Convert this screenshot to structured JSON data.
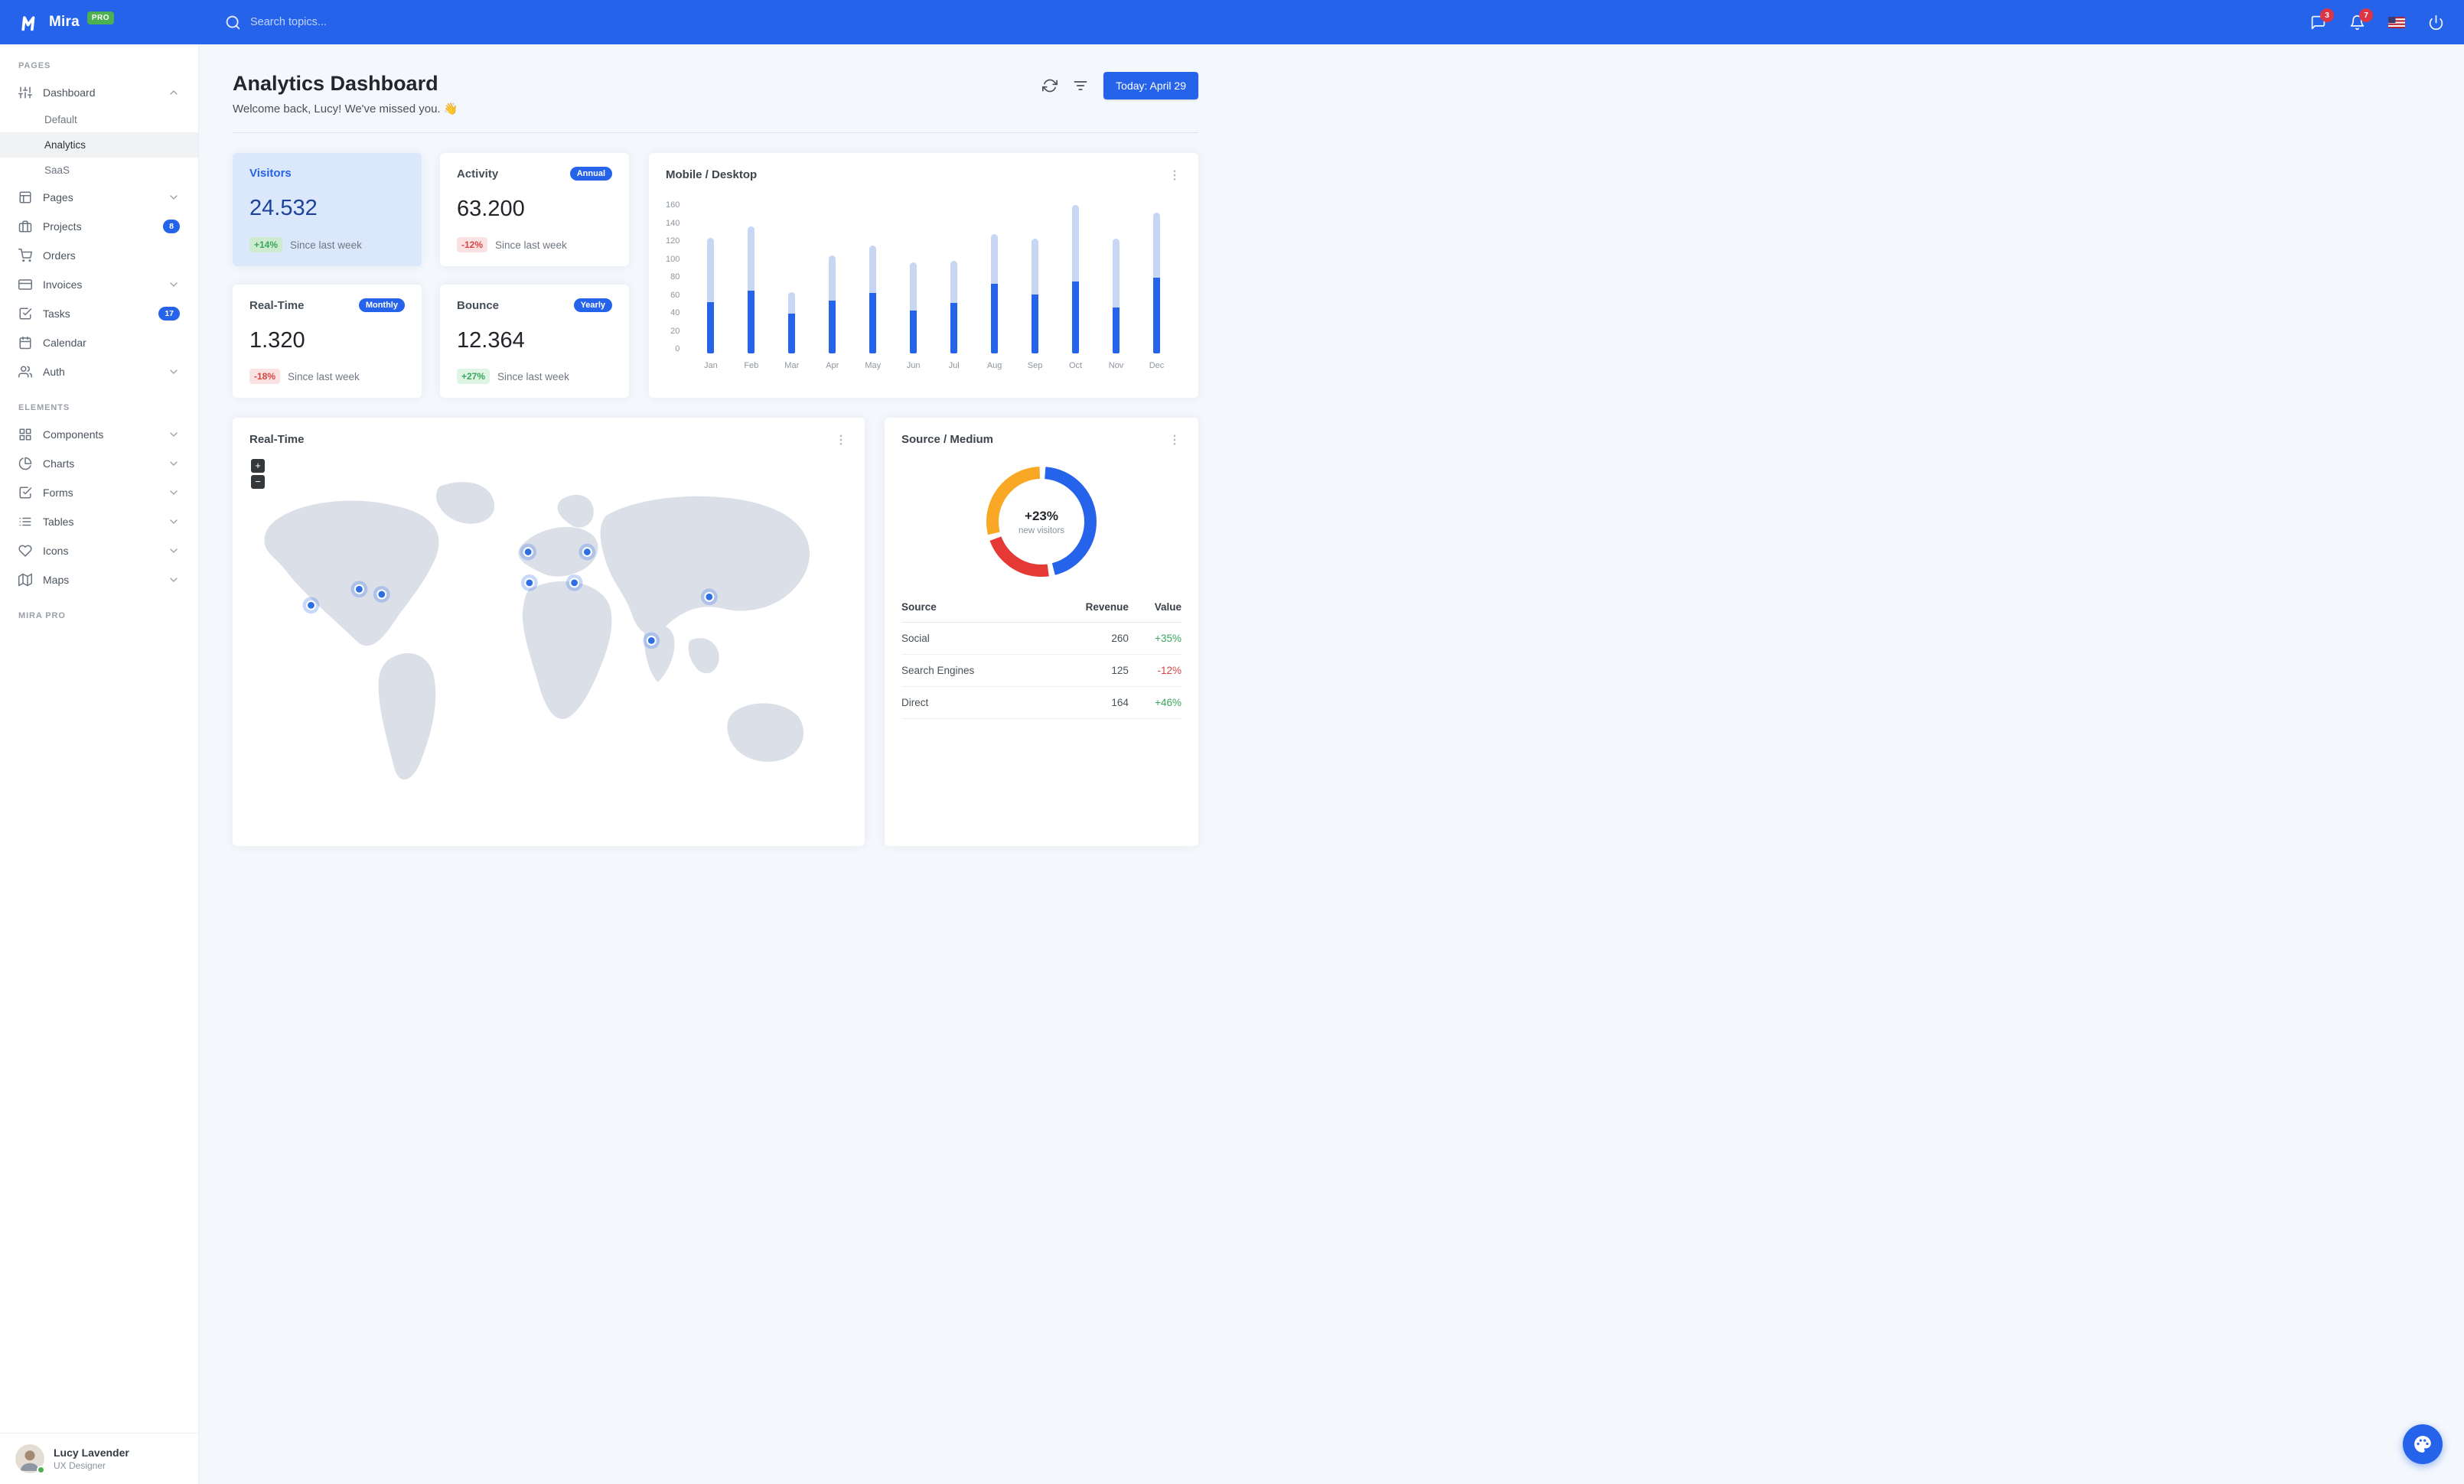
{
  "theme": {
    "primary": "#2563eb",
    "navbar_bg": "#2563eb",
    "badge_red": "#dc3545",
    "success_green": "#3aa65b",
    "danger_red": "#d64545",
    "pro_badge_green": "#4caf50",
    "highlight_card_bg": "#dbe7fa",
    "body_bg": "#f4f7fc"
  },
  "navbar": {
    "brand": "Mira",
    "brand_badge": "PRO",
    "search_placeholder": "Search topics...",
    "messages_badge": "3",
    "alerts_badge": "7"
  },
  "sidebar": {
    "sections": [
      {
        "label": "Pages",
        "items": [
          {
            "label": "Dashboard",
            "icon": "sliders",
            "state": "expanded",
            "children": [
              {
                "label": "Default"
              },
              {
                "label": "Analytics",
                "active": true
              },
              {
                "label": "SaaS"
              }
            ]
          },
          {
            "label": "Pages",
            "icon": "layout",
            "chevron": "down"
          },
          {
            "label": "Projects",
            "icon": "briefcase",
            "badge": "8"
          },
          {
            "label": "Orders",
            "icon": "shopping-cart"
          },
          {
            "label": "Invoices",
            "icon": "credit-card",
            "chevron": "down"
          },
          {
            "label": "Tasks",
            "icon": "check-square",
            "badge": "17"
          },
          {
            "label": "Calendar",
            "icon": "calendar"
          },
          {
            "label": "Auth",
            "icon": "users",
            "chevron": "down"
          }
        ]
      },
      {
        "label": "Elements",
        "items": [
          {
            "label": "Components",
            "icon": "grid",
            "chevron": "down"
          },
          {
            "label": "Charts",
            "icon": "pie-chart",
            "chevron": "down"
          },
          {
            "label": "Forms",
            "icon": "check-square",
            "chevron": "down"
          },
          {
            "label": "Tables",
            "icon": "list",
            "chevron": "down"
          },
          {
            "label": "Icons",
            "icon": "heart",
            "chevron": "down"
          },
          {
            "label": "Maps",
            "icon": "map",
            "chevron": "down"
          }
        ]
      },
      {
        "label": "Mira Pro",
        "items": []
      }
    ],
    "user": {
      "name": "Lucy Lavender",
      "role": "UX Designer",
      "status": "online"
    }
  },
  "header": {
    "title": "Analytics Dashboard",
    "subtitle": "Welcome back, Lucy! We've missed you. 👋",
    "today_button": "Today: April 29"
  },
  "stats": [
    {
      "title": "Visitors",
      "badge": null,
      "value": "24.532",
      "delta": "+14%",
      "delta_type": "positive",
      "caption": "Since last week",
      "highlight": true
    },
    {
      "title": "Activity",
      "badge": "Annual",
      "value": "63.200",
      "delta": "-12%",
      "delta_type": "negative",
      "caption": "Since last week",
      "highlight": false
    },
    {
      "title": "Real-Time",
      "badge": "Monthly",
      "value": "1.320",
      "delta": "-18%",
      "delta_type": "negative",
      "caption": "Since last week",
      "highlight": false
    },
    {
      "title": "Bounce",
      "badge": "Yearly",
      "value": "12.364",
      "delta": "+27%",
      "delta_type": "positive",
      "caption": "Since last week",
      "highlight": false
    }
  ],
  "chart_data": [
    {
      "type": "bar",
      "title": "Mobile / Desktop",
      "stacked": true,
      "categories": [
        "Jan",
        "Feb",
        "Mar",
        "Apr",
        "May",
        "Jun",
        "Jul",
        "Aug",
        "Sep",
        "Oct",
        "Nov",
        "Dec"
      ],
      "series": [
        {
          "name": "Mobile",
          "color": "#2563eb",
          "values": [
            54,
            66,
            42,
            55,
            63,
            45,
            53,
            73,
            62,
            75,
            48,
            79
          ]
        },
        {
          "name": "Desktop",
          "color": "#c7d6f3",
          "values": [
            67,
            67,
            22,
            47,
            50,
            50,
            44,
            52,
            58,
            80,
            72,
            68
          ]
        }
      ],
      "ylim": [
        0,
        160
      ],
      "yticks": [
        0,
        20,
        40,
        60,
        80,
        100,
        120,
        140,
        160
      ],
      "grid": false,
      "legend": "none"
    },
    {
      "type": "pie",
      "title": "Source / Medium",
      "center_value": "+23%",
      "center_label": "new visitors",
      "slices": [
        {
          "name": "Social",
          "value": 260,
          "color": "#2563eb"
        },
        {
          "name": "Search Engines",
          "value": 125,
          "color": "#e53935"
        },
        {
          "name": "Direct",
          "value": 164,
          "color": "#f9a825"
        }
      ],
      "legend": "none"
    }
  ],
  "realtime": {
    "title": "Real-Time",
    "zoom_in": "+",
    "zoom_out": "−",
    "markers": [
      {
        "x": 130,
        "y": 235
      },
      {
        "x": 205,
        "y": 210
      },
      {
        "x": 240,
        "y": 218
      },
      {
        "x": 468,
        "y": 152
      },
      {
        "x": 470,
        "y": 200
      },
      {
        "x": 540,
        "y": 200
      },
      {
        "x": 560,
        "y": 152
      },
      {
        "x": 660,
        "y": 290
      },
      {
        "x": 750,
        "y": 222
      }
    ]
  },
  "source_medium": {
    "table": {
      "headers": [
        "Source",
        "Revenue",
        "Value"
      ],
      "rows": [
        [
          "Social",
          "260",
          "+35%"
        ],
        [
          "Search Engines",
          "125",
          "-12%"
        ],
        [
          "Direct",
          "164",
          "+46%"
        ]
      ]
    }
  }
}
